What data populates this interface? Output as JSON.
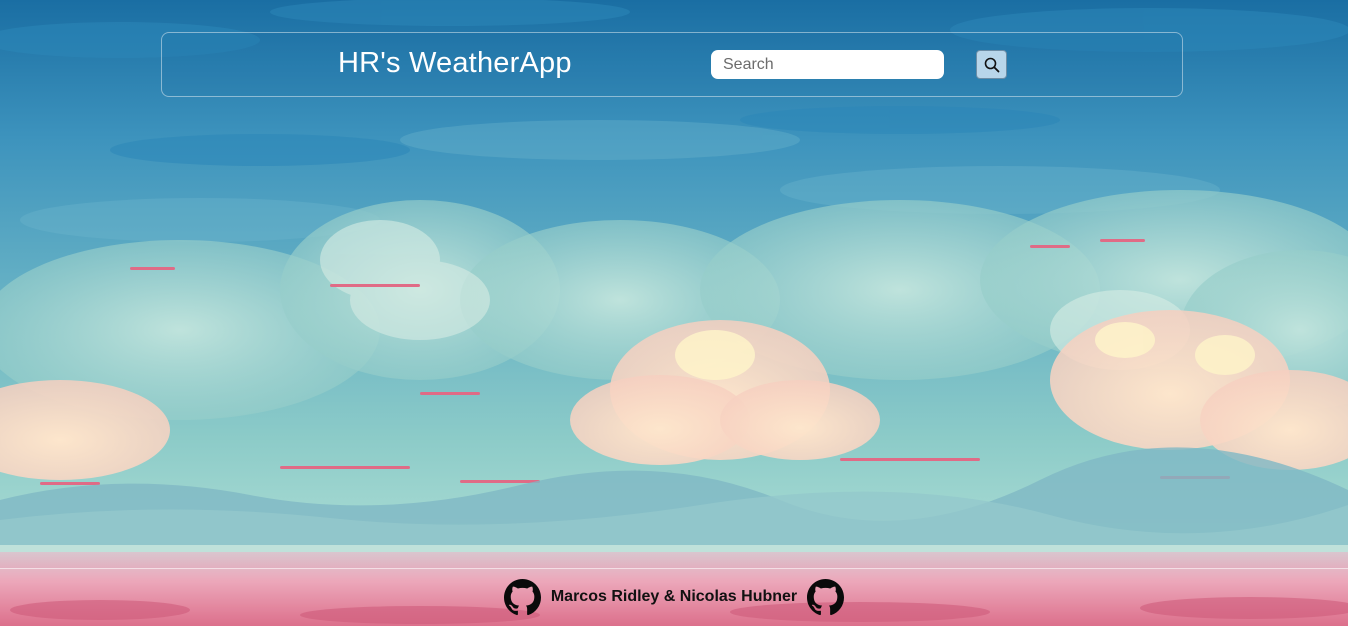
{
  "header": {
    "title": "HR's WeatherApp",
    "search": {
      "placeholder": "Search",
      "value": ""
    },
    "search_button_icon": "search-icon"
  },
  "footer": {
    "credits": "Marcos Ridley & Nicolas Hubner",
    "left_link_icon": "github-icon",
    "right_link_icon": "github-icon"
  },
  "colors": {
    "sky_top": "#1e74a8",
    "sky_mid": "#5aa9c6",
    "horizon": "#9cd3cf",
    "flower_field": "#e88aa2",
    "text_on_header": "#ffffff",
    "footer_text": "#111111"
  }
}
